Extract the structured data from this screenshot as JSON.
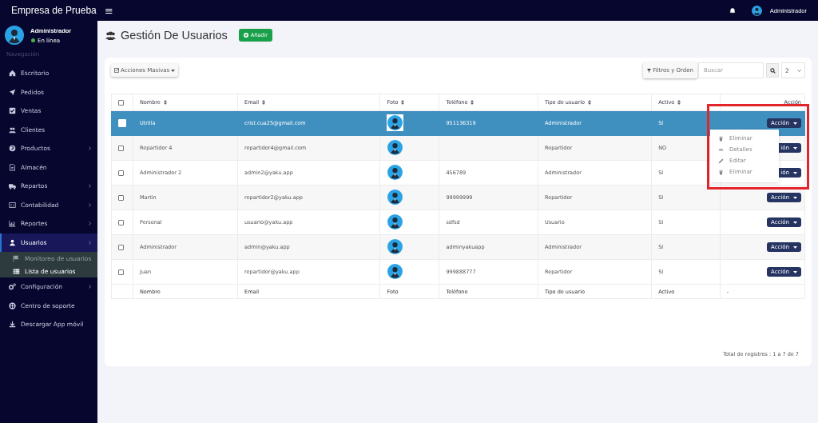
{
  "topbar": {
    "brand": "Empresa de Prueba",
    "menu_glyph": "≡",
    "user": "Administrador"
  },
  "sidebar": {
    "user": {
      "name": "Administrador",
      "status": "En línea"
    },
    "section": "Navegación",
    "items": [
      {
        "label": "Escritorio",
        "selected": false,
        "expandable": false
      },
      {
        "label": "Pedidos",
        "selected": false,
        "expandable": false
      },
      {
        "label": "Ventas",
        "selected": false,
        "expandable": false
      },
      {
        "label": "Clientes",
        "selected": false,
        "expandable": false
      },
      {
        "label": "Productos",
        "selected": false,
        "expandable": true
      },
      {
        "label": "Almacén",
        "selected": false,
        "expandable": false
      },
      {
        "label": "Repartos",
        "selected": false,
        "expandable": true
      },
      {
        "label": "Contabilidad",
        "selected": false,
        "expandable": true
      },
      {
        "label": "Reportes",
        "selected": false,
        "expandable": true
      },
      {
        "label": "Usuarios",
        "selected": true,
        "expandable": true,
        "children": [
          {
            "label": "Monitoreo de usuarios",
            "selected": false
          },
          {
            "label": "Lista de usuarios",
            "selected": true
          }
        ]
      },
      {
        "label": "Configuración",
        "selected": false,
        "expandable": true
      },
      {
        "label": "Centro de soporte",
        "selected": false,
        "expandable": false
      },
      {
        "label": "Descargar App móvil",
        "selected": false,
        "expandable": false
      }
    ]
  },
  "page": {
    "title": "Gestión De Usuarios",
    "add_button": "Añadir"
  },
  "toolbar": {
    "bulk_button": "Acciones Masivas",
    "filter_button": "Filtros y Orden",
    "search": {
      "placeholder": "Buscar"
    },
    "page_size": "2"
  },
  "table": {
    "select_all_checked": false,
    "columns": [
      "Nombre",
      "Email",
      "Foto",
      "Teléfono",
      "Tipo de usuario",
      "Activo",
      "Acción"
    ],
    "rows": [
      {
        "selected": true,
        "nombre": "Utrilla",
        "email": "crist.cua25@gmail.com",
        "telefono": "951136319",
        "tipo": "Administrador",
        "activo": "SI",
        "action": "Acción"
      },
      {
        "selected": false,
        "nombre": "Repartidor 4",
        "email": "repartidor4@gmail.com",
        "telefono": "",
        "tipo": "Repartidor",
        "activo": "NO",
        "action": "ión"
      },
      {
        "selected": false,
        "nombre": "Administrador 2",
        "email": "admin2@yaku.app",
        "telefono": "456789",
        "tipo": "Administrador",
        "activo": "SI",
        "action": "ión"
      },
      {
        "selected": false,
        "nombre": "Martin",
        "email": "repartidor2@yaku.app",
        "telefono": "99999999",
        "tipo": "Repartidor",
        "activo": "SI",
        "action": "Acción"
      },
      {
        "selected": false,
        "nombre": "Personal",
        "email": "usuario@yaku.app",
        "telefono": "sdfsd",
        "tipo": "Usuario",
        "activo": "SI",
        "action": "Acción"
      },
      {
        "selected": false,
        "nombre": "Administrador",
        "email": "admin@yaku.app",
        "telefono": "adminyakuapp",
        "tipo": "Administrador",
        "activo": "SI",
        "action": "Acción"
      },
      {
        "selected": false,
        "nombre": "Juan",
        "email": "repartidor@yaku.app",
        "telefono": "999888777",
        "tipo": "Repartidor",
        "activo": "SI",
        "action": "Acción"
      }
    ],
    "footer": [
      "Nombre",
      "Email",
      "Foto",
      "Teléfono",
      "Tipo de usuario",
      "Activo",
      "-"
    ],
    "total": "Total de registros : 1 a 7 de 7"
  },
  "action_menu": {
    "items": [
      {
        "kind": "trash",
        "label": "Eliminar"
      },
      {
        "kind": "eye",
        "label": "Detalles"
      },
      {
        "kind": "pencil",
        "label": "Editar"
      },
      {
        "kind": "trash",
        "label": "Eliminar"
      }
    ]
  }
}
